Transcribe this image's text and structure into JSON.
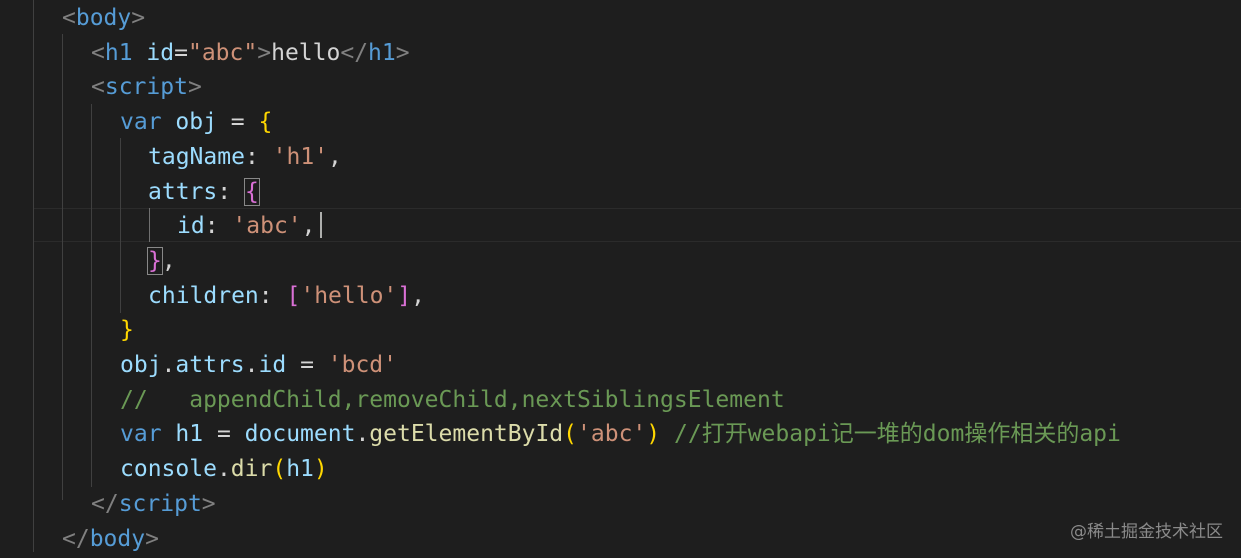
{
  "editor": {
    "lines": [
      {
        "tokens": [
          {
            "c": "t-br",
            "t": "<"
          },
          {
            "c": "t-tag",
            "t": "body"
          },
          {
            "c": "t-br",
            "t": ">"
          }
        ]
      },
      {
        "tokens": [
          {
            "c": "t-br",
            "t": "<"
          },
          {
            "c": "t-tag",
            "t": "h1"
          },
          {
            "c": "t-op",
            "t": " "
          },
          {
            "c": "t-attr",
            "t": "id"
          },
          {
            "c": "t-op",
            "t": "="
          },
          {
            "c": "t-str",
            "t": "\"abc\""
          },
          {
            "c": "t-br",
            "t": ">"
          },
          {
            "c": "t-op",
            "t": "hello"
          },
          {
            "c": "t-br",
            "t": "</"
          },
          {
            "c": "t-tag",
            "t": "h1"
          },
          {
            "c": "t-br",
            "t": ">"
          }
        ]
      },
      {
        "tokens": [
          {
            "c": "t-br",
            "t": "<"
          },
          {
            "c": "t-tag",
            "t": "script"
          },
          {
            "c": "t-br",
            "t": ">"
          }
        ]
      },
      {
        "tokens": [
          {
            "c": "t-kw",
            "t": "var"
          },
          {
            "c": "t-op",
            "t": " "
          },
          {
            "c": "t-var",
            "t": "obj"
          },
          {
            "c": "t-op",
            "t": " = "
          },
          {
            "c": "t-p1",
            "t": "{"
          }
        ]
      },
      {
        "tokens": [
          {
            "c": "t-var",
            "t": "tagName"
          },
          {
            "c": "t-op",
            "t": ": "
          },
          {
            "c": "t-str",
            "t": "'h1'"
          },
          {
            "c": "t-op",
            "t": ","
          }
        ]
      },
      {
        "tokens": [
          {
            "c": "t-var",
            "t": "attrs"
          },
          {
            "c": "t-op",
            "t": ": "
          },
          {
            "c": "t-p2 match-box",
            "t": "{"
          }
        ]
      },
      {
        "tokens": [
          {
            "c": "t-var",
            "t": "id"
          },
          {
            "c": "t-op",
            "t": ": "
          },
          {
            "c": "t-str",
            "t": "'abc'"
          },
          {
            "c": "t-op",
            "t": ","
          }
        ]
      },
      {
        "tokens": [
          {
            "c": "t-p2 match-box",
            "t": "}"
          },
          {
            "c": "t-op",
            "t": ","
          }
        ]
      },
      {
        "tokens": [
          {
            "c": "t-var",
            "t": "children"
          },
          {
            "c": "t-op",
            "t": ": "
          },
          {
            "c": "t-p2",
            "t": "["
          },
          {
            "c": "t-str",
            "t": "'hello'"
          },
          {
            "c": "t-p2",
            "t": "]"
          },
          {
            "c": "t-op",
            "t": ","
          }
        ]
      },
      {
        "tokens": [
          {
            "c": "t-p1",
            "t": "}"
          }
        ]
      },
      {
        "tokens": [
          {
            "c": "t-var",
            "t": "obj"
          },
          {
            "c": "t-op",
            "t": "."
          },
          {
            "c": "t-var",
            "t": "attrs"
          },
          {
            "c": "t-op",
            "t": "."
          },
          {
            "c": "t-var",
            "t": "id"
          },
          {
            "c": "t-op",
            "t": " = "
          },
          {
            "c": "t-str",
            "t": "'bcd'"
          }
        ]
      },
      {
        "tokens": [
          {
            "c": "t-cm",
            "t": "//   appendChild,removeChild,nextSiblingsElement"
          }
        ]
      },
      {
        "tokens": [
          {
            "c": "t-kw",
            "t": "var"
          },
          {
            "c": "t-op",
            "t": " "
          },
          {
            "c": "t-var",
            "t": "h1"
          },
          {
            "c": "t-op",
            "t": " = "
          },
          {
            "c": "t-var",
            "t": "document"
          },
          {
            "c": "t-op",
            "t": "."
          },
          {
            "c": "t-fn",
            "t": "getElementById"
          },
          {
            "c": "t-p1",
            "t": "("
          },
          {
            "c": "t-str",
            "t": "'abc'"
          },
          {
            "c": "t-p1",
            "t": ")"
          },
          {
            "c": "t-op",
            "t": " "
          },
          {
            "c": "t-cm",
            "t": "//打开webapi记一堆的dom操作相关的api"
          }
        ]
      },
      {
        "tokens": [
          {
            "c": "t-var",
            "t": "console"
          },
          {
            "c": "t-op",
            "t": "."
          },
          {
            "c": "t-fn",
            "t": "dir"
          },
          {
            "c": "t-p1",
            "t": "("
          },
          {
            "c": "t-var",
            "t": "h1"
          },
          {
            "c": "t-p1",
            "t": ")"
          }
        ]
      },
      {
        "tokens": [
          {
            "c": "t-br",
            "t": "</"
          },
          {
            "c": "t-tag",
            "t": "script"
          },
          {
            "c": "t-br",
            "t": ">"
          }
        ]
      },
      {
        "tokens": [
          {
            "c": "t-br",
            "t": "</"
          },
          {
            "c": "t-tag",
            "t": "body"
          },
          {
            "c": "t-br",
            "t": ">"
          }
        ]
      }
    ]
  },
  "watermark": "@稀土掘金技术社区"
}
